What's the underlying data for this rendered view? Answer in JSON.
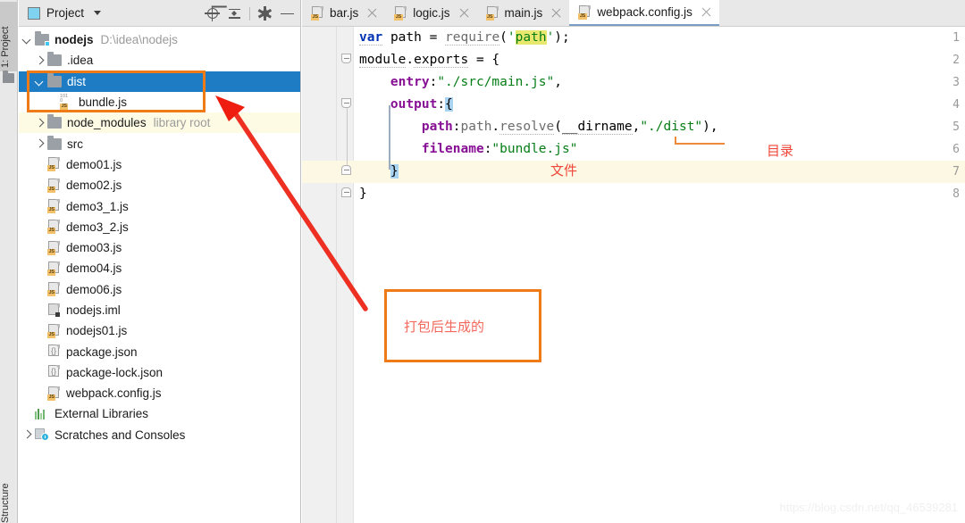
{
  "toolstrip": {
    "project_tab": "1: Project",
    "structure_tab": "Structure"
  },
  "project_panel": {
    "title": "Project",
    "tools": [
      {
        "name": "locate-icon",
        "label": "Select Opened File"
      },
      {
        "name": "collapse-all-icon",
        "label": "Collapse All"
      },
      {
        "name": "gear-icon",
        "label": "Settings"
      },
      {
        "name": "minimize-icon",
        "label": "Hide"
      }
    ],
    "tree": [
      {
        "label": "nodejs",
        "suffix": "D:\\idea\\nodejs",
        "icon": "module-folder-icon",
        "arrow": "down",
        "depth": 0,
        "bold": true,
        "state": "normal"
      },
      {
        "label": ".idea",
        "suffix": "",
        "icon": "folder-icon",
        "arrow": "right",
        "depth": 1,
        "bold": false,
        "state": "normal"
      },
      {
        "label": "dist",
        "suffix": "",
        "icon": "folder-icon",
        "arrow": "down",
        "depth": 1,
        "bold": false,
        "state": "selected"
      },
      {
        "label": "bundle.js",
        "suffix": "",
        "icon": "bundle-js-icon",
        "arrow": "none",
        "depth": 2,
        "bold": false,
        "state": "normal"
      },
      {
        "label": "node_modules",
        "suffix": "library root",
        "icon": "folder-icon",
        "arrow": "right",
        "depth": 1,
        "bold": false,
        "state": "library"
      },
      {
        "label": "src",
        "suffix": "",
        "icon": "folder-icon",
        "arrow": "right",
        "depth": 1,
        "bold": false,
        "state": "normal"
      },
      {
        "label": "demo01.js",
        "suffix": "",
        "icon": "js-file-icon",
        "arrow": "none",
        "depth": 1,
        "bold": false,
        "state": "normal"
      },
      {
        "label": "demo02.js",
        "suffix": "",
        "icon": "js-file-icon",
        "arrow": "none",
        "depth": 1,
        "bold": false,
        "state": "normal"
      },
      {
        "label": "demo3_1.js",
        "suffix": "",
        "icon": "js-file-icon",
        "arrow": "none",
        "depth": 1,
        "bold": false,
        "state": "normal"
      },
      {
        "label": "demo3_2.js",
        "suffix": "",
        "icon": "js-file-icon",
        "arrow": "none",
        "depth": 1,
        "bold": false,
        "state": "normal"
      },
      {
        "label": "demo03.js",
        "suffix": "",
        "icon": "js-file-icon",
        "arrow": "none",
        "depth": 1,
        "bold": false,
        "state": "normal"
      },
      {
        "label": "demo04.js",
        "suffix": "",
        "icon": "js-file-icon",
        "arrow": "none",
        "depth": 1,
        "bold": false,
        "state": "normal"
      },
      {
        "label": "demo06.js",
        "suffix": "",
        "icon": "js-file-icon",
        "arrow": "none",
        "depth": 1,
        "bold": false,
        "state": "normal"
      },
      {
        "label": "nodejs.iml",
        "suffix": "",
        "icon": "iml-file-icon",
        "arrow": "none",
        "depth": 1,
        "bold": false,
        "state": "normal"
      },
      {
        "label": "nodejs01.js",
        "suffix": "",
        "icon": "js-file-icon",
        "arrow": "none",
        "depth": 1,
        "bold": false,
        "state": "normal"
      },
      {
        "label": "package.json",
        "suffix": "",
        "icon": "json-file-icon",
        "arrow": "none",
        "depth": 1,
        "bold": false,
        "state": "normal"
      },
      {
        "label": "package-lock.json",
        "suffix": "",
        "icon": "json-file-icon",
        "arrow": "none",
        "depth": 1,
        "bold": false,
        "state": "normal"
      },
      {
        "label": "webpack.config.js",
        "suffix": "",
        "icon": "js-file-icon",
        "arrow": "none",
        "depth": 1,
        "bold": false,
        "state": "normal"
      },
      {
        "label": "External Libraries",
        "suffix": "",
        "icon": "external-libraries-icon",
        "arrow": "none",
        "depth": 0,
        "bold": false,
        "state": "normal"
      },
      {
        "label": "Scratches and Consoles",
        "suffix": "",
        "icon": "scratches-icon",
        "arrow": "right",
        "depth": 0,
        "bold": false,
        "state": "normal"
      }
    ]
  },
  "editor": {
    "tabs": [
      {
        "label": "bar.js",
        "active": false
      },
      {
        "label": "logic.js",
        "active": false
      },
      {
        "label": "main.js",
        "active": false
      },
      {
        "label": "webpack.config.js",
        "active": true
      }
    ],
    "line_numbers": [
      "1",
      "2",
      "3",
      "4",
      "5",
      "6",
      "7",
      "8"
    ],
    "current_line": 7,
    "lines": [
      "var path = require('path');",
      "module.exports = {",
      "    entry:\"./src/main.js\",",
      "    output:{",
      "        path:path.resolve(__dirname,\"./dist\"),",
      "        filename:\"bundle.js\"",
      "    }",
      "}"
    ]
  },
  "annotations": {
    "box_note": "打包后生成的",
    "directory_label": "目录",
    "file_label": "文件"
  },
  "watermark": "https://blog.csdn.net/qq_46539281",
  "colors": {
    "selection_blue": "#1d7cc4",
    "annotation_orange": "#ef7b17",
    "annotation_red": "#f0453a",
    "library_row": "#fdfbe4",
    "current_line": "#fcf8e3"
  }
}
